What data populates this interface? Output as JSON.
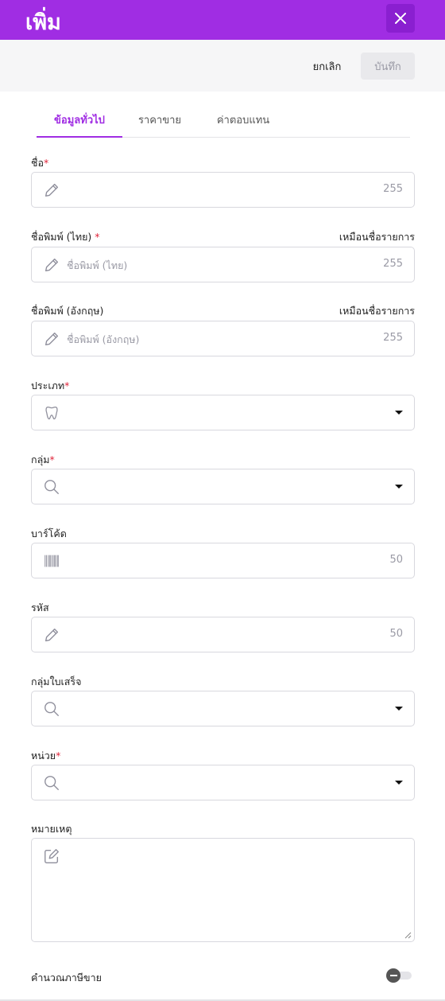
{
  "header": {
    "title": "เพิ่ม"
  },
  "actions": {
    "cancel_label": "ยกเลิก",
    "save_label": "บันทึก"
  },
  "tabs": [
    {
      "label": "ข้อมูลทั่วไป",
      "active": true
    },
    {
      "label": "ราคาขาย",
      "active": false
    },
    {
      "label": "ค่าตอบแทน",
      "active": false
    }
  ],
  "fields": {
    "name": {
      "label": "ชื่อ",
      "required": "*",
      "value": "",
      "max": "255"
    },
    "print_name_th": {
      "label": "ชื่อพิมพ์ (ไทย)",
      "required": "*",
      "same_as": "เหมือนชื่อรายการ",
      "placeholder": "ชื่อพิมพ์ (ไทย)",
      "max": "255"
    },
    "print_name_en": {
      "label": "ชื่อพิมพ์ (อังกฤษ)",
      "same_as": "เหมือนชื่อรายการ",
      "placeholder": "ชื่อพิมพ์ (อังกฤษ)",
      "max": "255"
    },
    "type": {
      "label": "ประเภท",
      "required": "*"
    },
    "group": {
      "label": "กลุ่ม",
      "required": "*"
    },
    "barcode": {
      "label": "บาร์โค้ด",
      "max": "50"
    },
    "code": {
      "label": "รหัส",
      "max": "50"
    },
    "receipt_group": {
      "label": "กลุ่มใบเสร็จ"
    },
    "unit": {
      "label": "หน่วย",
      "required": "*"
    },
    "note": {
      "label": "หมายเหตุ"
    },
    "sales_tax": {
      "label": "คำนวณภาษีขาย",
      "enabled": false
    }
  },
  "colors": {
    "accent": "#a02de3",
    "required": "#e0243a"
  },
  "icons": {
    "close": "close-icon",
    "pencil": "pencil-icon",
    "tooth": "tooth-icon",
    "search": "search-icon",
    "barcode": "barcode-icon",
    "edit": "edit-box-icon"
  }
}
